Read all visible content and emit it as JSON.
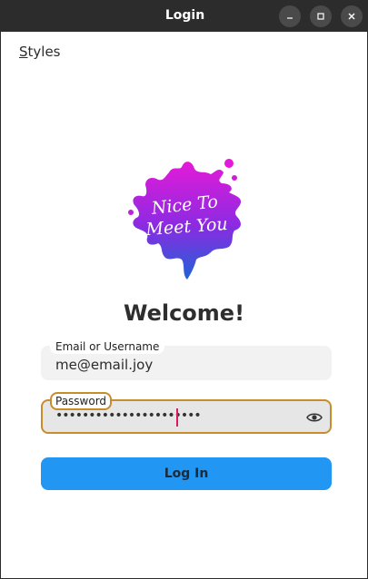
{
  "window": {
    "title": "Login",
    "controls": {
      "minimize_icon": "minimize-icon",
      "maximize_icon": "maximize-icon",
      "close_icon": "close-icon"
    }
  },
  "menu": {
    "styles_first": "S",
    "styles_rest": "tyles"
  },
  "logo": {
    "line1": "Nice To",
    "line2": "Meet You",
    "colors": [
      "#e020d0",
      "#8a2be2",
      "#2a5fd8"
    ]
  },
  "welcome": "Welcome!",
  "email": {
    "label": "Email or Username",
    "value": "me@email.joy"
  },
  "password": {
    "label": "Password",
    "masked_value": "••••••••••••••••••••••",
    "toggle_icon": "eye-icon"
  },
  "login_button": {
    "label": "Log In",
    "color": "#2196f3"
  },
  "colors": {
    "titlebar": "#2c2c2c",
    "focus": "#c78d2d",
    "caret": "#d81b60"
  }
}
